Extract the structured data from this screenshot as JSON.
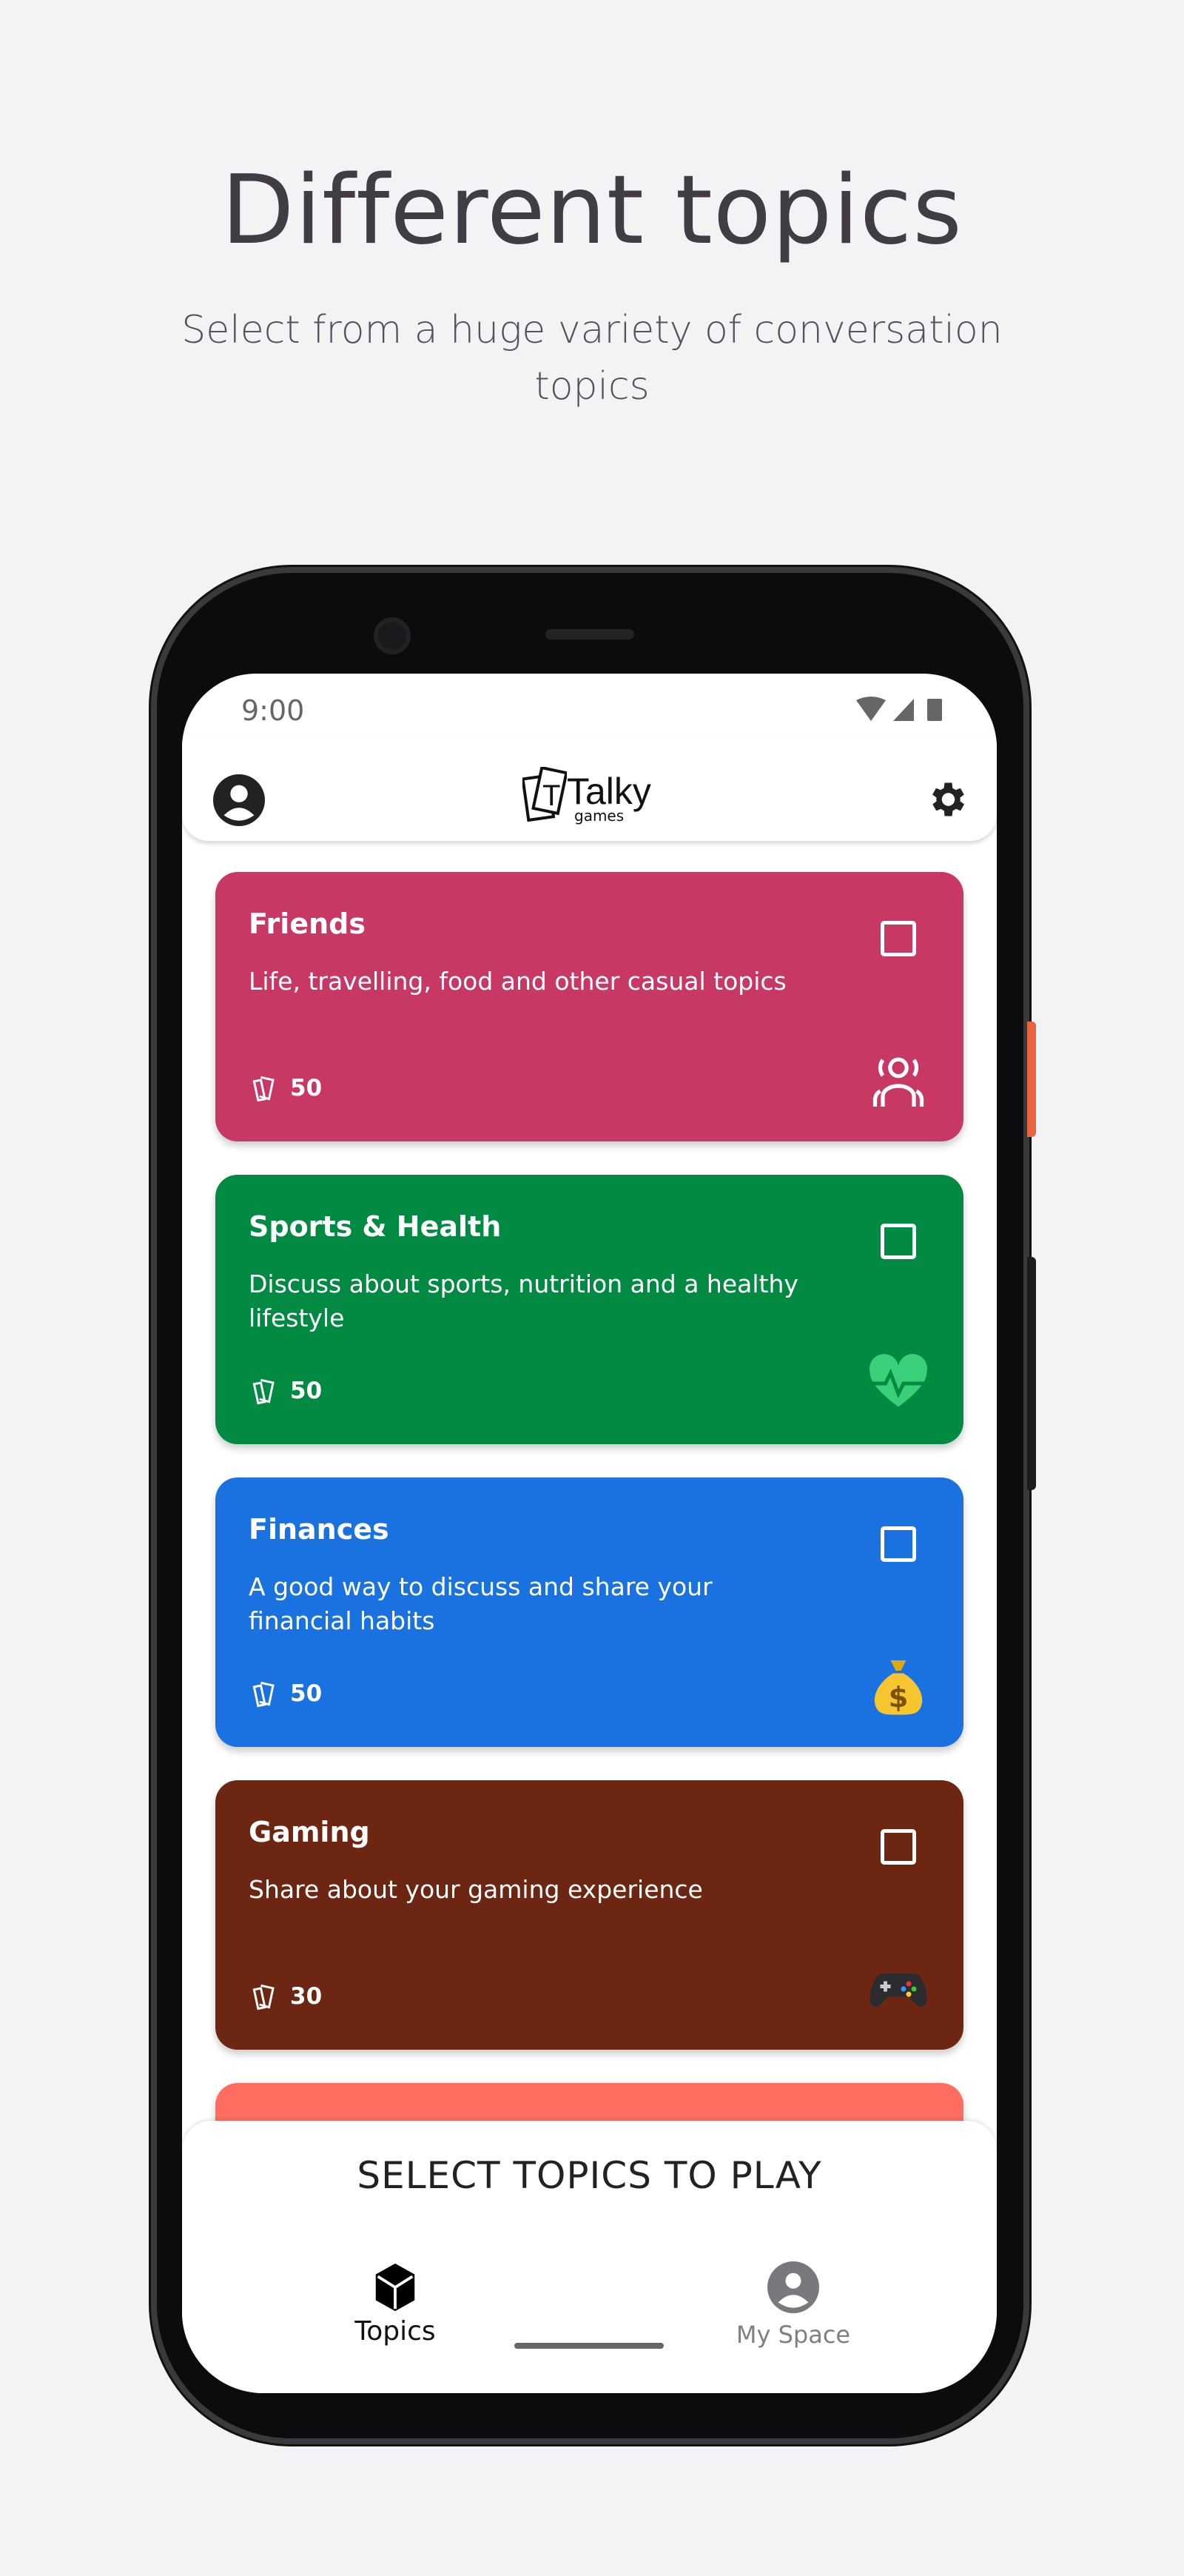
{
  "hero": {
    "title": "Different topics",
    "subtitle": "Select from a huge variety of conversation topics"
  },
  "status_bar": {
    "time": "9:00",
    "icons": [
      "wifi-icon",
      "signal-icon",
      "battery-icon"
    ]
  },
  "header": {
    "logo_text": "Talky",
    "logo_sub": "games",
    "left_icon": "account-icon",
    "right_icon": "gear-icon"
  },
  "topics": [
    {
      "title": "Friends",
      "description": "Life, travelling, food and other casual topics",
      "count": "50",
      "color": "#c83865",
      "icon": "friends-icon",
      "checked": false
    },
    {
      "title": "Sports & Health",
      "description": "Discuss about sports, nutrition and a healthy lifestyle",
      "count": "50",
      "color": "#028a43",
      "icon": "heart-pulse-icon",
      "checked": false
    },
    {
      "title": "Finances",
      "description": "A good way to discuss and share your financial habits",
      "count": "50",
      "color": "#1a72e0",
      "icon": "money-bag-icon",
      "checked": false
    },
    {
      "title": "Gaming",
      "description": "Share about your gaming experience",
      "count": "30",
      "color": "#6d2612",
      "icon": "gamepad-icon",
      "checked": false
    },
    {
      "color": "#fe6d5f"
    }
  ],
  "cta": "SELECT TOPICS TO PLAY",
  "nav": [
    {
      "label": "Topics",
      "icon": "cube-icon",
      "active": true
    },
    {
      "label": "My Space",
      "icon": "account-icon",
      "active": false
    }
  ]
}
